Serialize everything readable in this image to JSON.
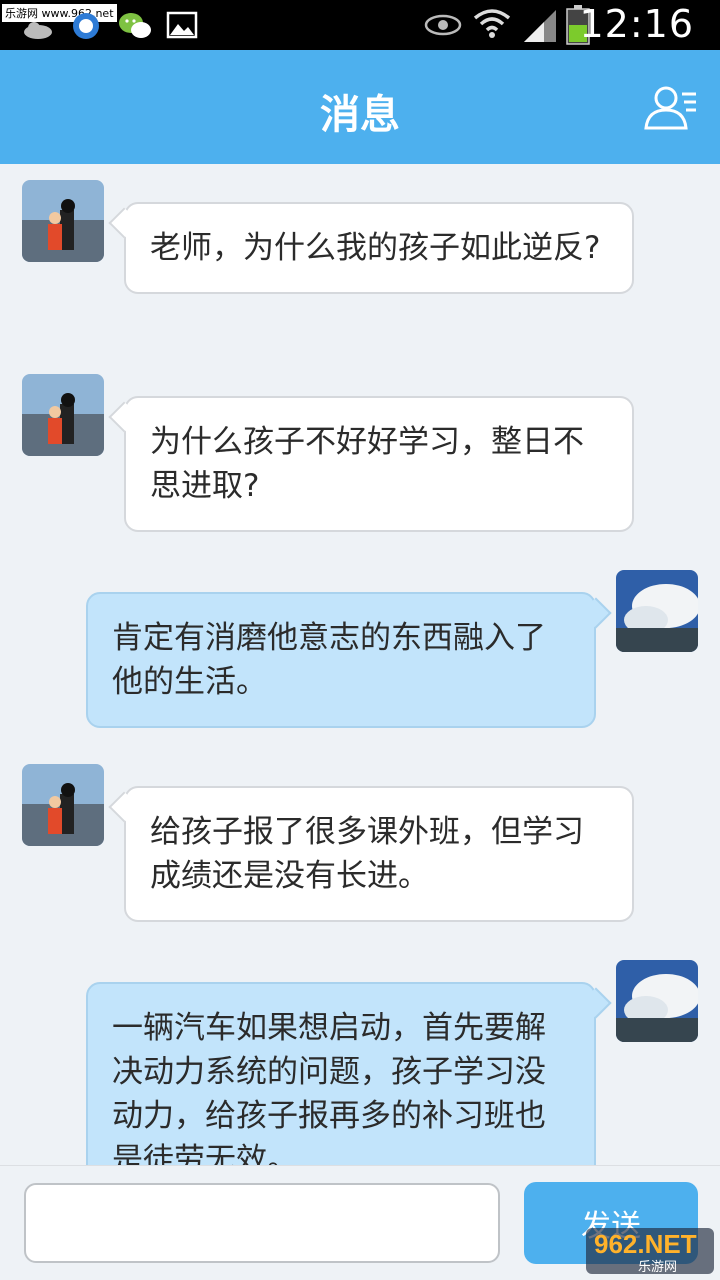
{
  "status_bar": {
    "watermark": "乐游网 www.962.net",
    "time": "12:16",
    "icons": [
      "cloud-icon",
      "qq-icon",
      "wechat-icon",
      "gallery-icon",
      "eye-icon",
      "wifi-icon",
      "signal-icon",
      "battery-icon"
    ]
  },
  "header": {
    "title": "消息",
    "contacts_icon": "contacts-icon"
  },
  "messages": [
    {
      "side": "left",
      "text": "老师，为什么我的孩子如此逆反?"
    },
    {
      "side": "left",
      "text": "为什么孩子不好好学习，整日不思进取?"
    },
    {
      "side": "right",
      "text": "肯定有消磨他意志的东西融入了他的生活。"
    },
    {
      "side": "left",
      "text": "给孩子报了很多课外班，但学习成绩还是没有长进。"
    },
    {
      "side": "right",
      "text": "一辆汽车如果想启动，首先要解决动力系统的问题，孩子学习没动力，给孩子报再多的补习班也是徒劳无效。"
    }
  ],
  "input": {
    "value": "",
    "placeholder": "",
    "send_label": "发送"
  },
  "bottom_watermark": {
    "brand": "962.NET",
    "label": "乐游网"
  },
  "colors": {
    "header": "#4db0ee",
    "left_bubble": "#ffffff",
    "right_bubble": "#c2e4fb",
    "background": "#eef2f6"
  }
}
